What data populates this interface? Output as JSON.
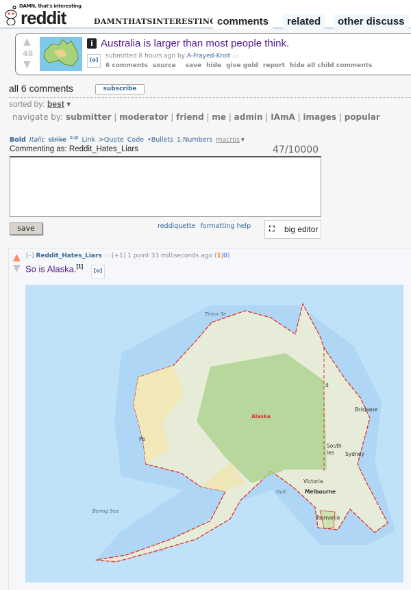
{
  "header": {
    "logo_tagline": "DAMN, that's interesting",
    "logo_word": "reddit",
    "subreddit": "DamnThatsInteresting",
    "tabs": [
      {
        "label": "comments",
        "selected": true
      },
      {
        "label": "related"
      },
      {
        "label": "other discuss"
      }
    ]
  },
  "post": {
    "score": "48",
    "title": "Australia is larger than most people think.",
    "flair_icon": "i",
    "submitted": "submitted 8 hours ago by",
    "author": "A-Frayed-Knot",
    "buttons": [
      "6 comments",
      "source",
      "save",
      "hide",
      "give gold",
      "report",
      "hide all child comments"
    ]
  },
  "comments_area": {
    "heading": "all 6 comments",
    "subscribe": "subscribe",
    "sorted_label": "sorted by:",
    "sorted_value": "best",
    "navigate_label": "navigate by:",
    "navigate": [
      "submitter",
      "moderator",
      "friend",
      "me",
      "admin",
      "IAmA",
      "images",
      "popular"
    ]
  },
  "editor": {
    "md": [
      "Bold",
      "Italic",
      "strike",
      "sup",
      "Link",
      ">Quote",
      "Code",
      "•Bullets",
      "1.Numbers",
      "macros"
    ],
    "commenting_as": "Commenting as: Reddit_Hates_Liars",
    "count": "47/10000",
    "save": "save",
    "reddiquette": "reddiquette",
    "formatting_help": "formatting help",
    "big_editor": "big editor"
  },
  "comment": {
    "collapse": "[–]",
    "author": "Reddit_Hates_Liars",
    "vote": "[+1]",
    "meta": "1 point 33 milliseconds ago",
    "up": "1",
    "down": "0",
    "body": "So is Alaska.",
    "footnote": "[1]"
  },
  "map": {
    "labels": {
      "timor": "Timor Se",
      "alaska": "Alaska",
      "brisbane": "Brisbane",
      "sydney": "Sydney",
      "south": "South",
      "wales": "les",
      "qld": "d",
      "victoria": "Victoria",
      "melbourne": "Melbourne",
      "gulf": "Gulf",
      "tasmania": "Tasmania",
      "bering": "Bering Sea",
      "perth": "Pe"
    },
    "colors": {
      "sea": "#bfe2f8",
      "outline": "#e03030"
    }
  }
}
